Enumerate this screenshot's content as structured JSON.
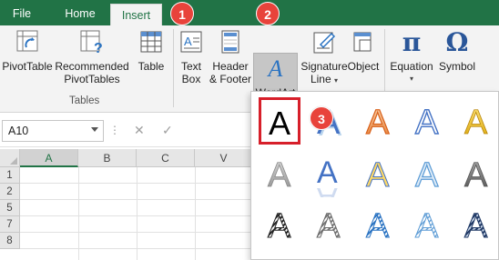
{
  "tabs": {
    "file": "File",
    "home": "Home",
    "insert": "Insert"
  },
  "ribbon": {
    "pivottable": "PivotTable",
    "recommended_line1": "Recommended",
    "recommended_line2": "PivotTables",
    "table": "Table",
    "tables_group": "Tables",
    "textbox_line1": "Text",
    "textbox_line2": "Box",
    "header_line1": "Header",
    "header_line2": "& Footer",
    "wordart": "WordArt",
    "signature_line1": "Signature",
    "signature_line2": "Line",
    "object": "Object",
    "equation": "Equation",
    "symbol": "Symbol",
    "equation_glyph": "π",
    "symbol_glyph": "Ω",
    "wordart_glyph": "A"
  },
  "formula_bar": {
    "name_box": "A10",
    "cancel_glyph": "✕",
    "enter_glyph": "✓"
  },
  "grid": {
    "columns": [
      "A",
      "B",
      "C",
      "V"
    ],
    "rows": [
      "1",
      "2",
      "5",
      "7",
      "8"
    ]
  },
  "gallery": {
    "glyph": "A",
    "styles": [
      "black-fill-plain",
      "blue-shadow",
      "orange-gradient-outline",
      "blue-outline-white",
      "gold-gradient",
      "gray-gradient",
      "blue-reflection",
      "yellow-outline",
      "light-blue-outline",
      "dark-gray-gradient",
      "black-pattern",
      "gray-pattern",
      "blue-pattern",
      "light-blue-pattern",
      "navy-pattern"
    ]
  },
  "badges": [
    "1",
    "2",
    "3"
  ],
  "colors": {
    "accent": "#217346",
    "badge": "#e8433b",
    "selection_border": "#d71f2a"
  }
}
